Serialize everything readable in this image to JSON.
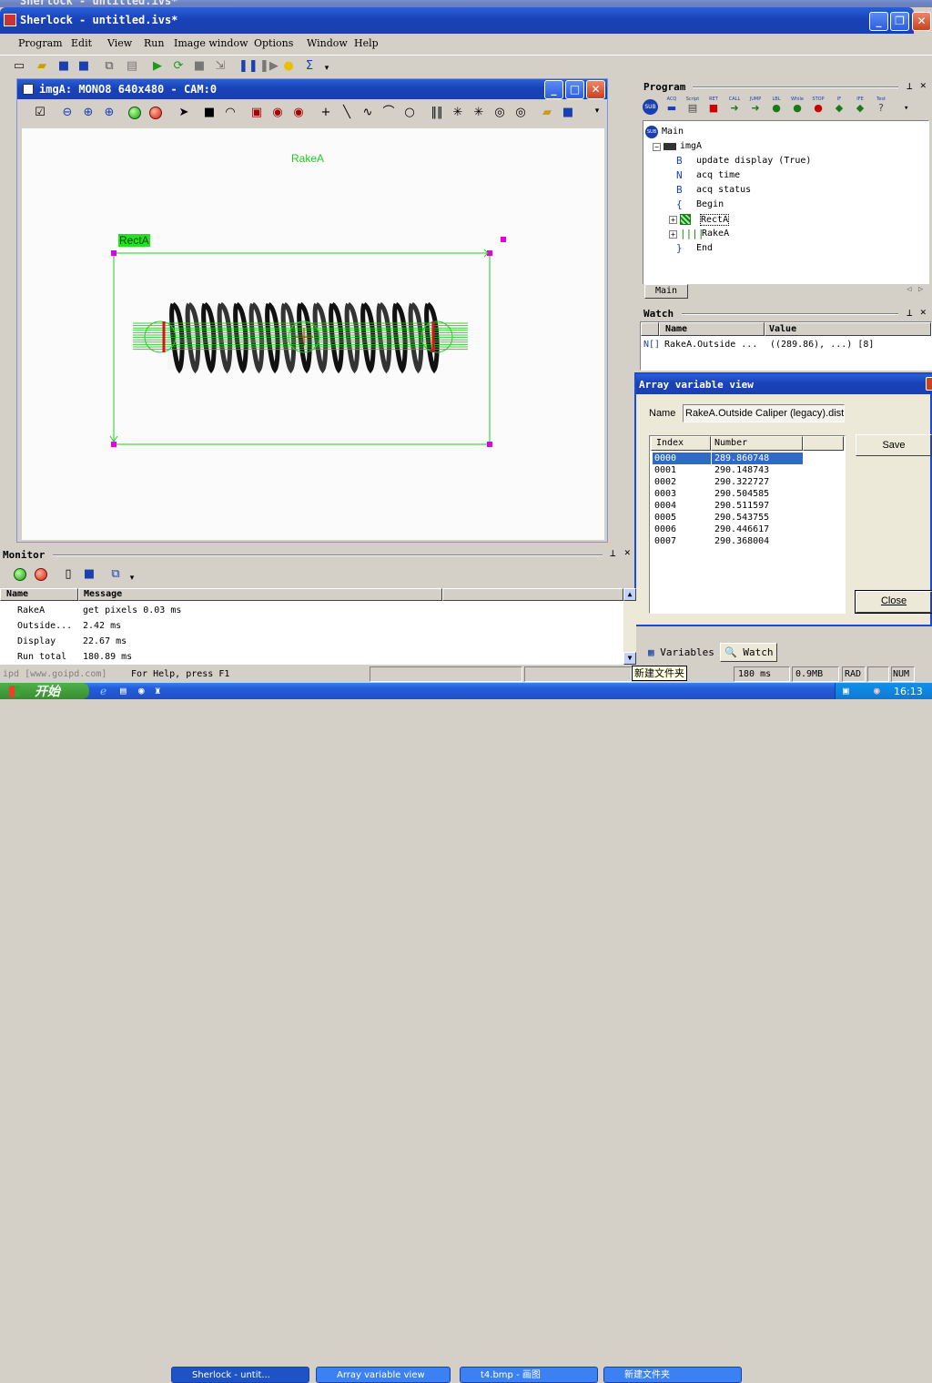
{
  "background_window": {
    "title": "Sherlock - untitled.ivs*"
  },
  "main_window": {
    "title": "Sherlock - untitled.ivs*",
    "menu": [
      "Program",
      "Edit",
      "View",
      "Run",
      "Image window",
      "Options",
      "Window",
      "Help"
    ]
  },
  "image_window": {
    "title": "imgA: MONO8 640x480 - CAM:0",
    "labels": {
      "rake": "RakeA",
      "rect": "RectA"
    }
  },
  "program_panel": {
    "title": "Program",
    "toolbar_labels": [
      "ACQ",
      "Script",
      "RET",
      "CALL",
      "JUMP",
      "LBL",
      "While",
      "STOP",
      "IF",
      "IFE",
      "Test"
    ],
    "tree": [
      {
        "icon": "SUB",
        "label": "Main"
      },
      {
        "icon": "",
        "label": "imgA"
      },
      {
        "icon": "B",
        "label": "update display (True)"
      },
      {
        "icon": "N",
        "label": "acq time"
      },
      {
        "icon": "B",
        "label": "acq status"
      },
      {
        "icon": "{",
        "label": "Begin"
      },
      {
        "icon": "",
        "label": "RectA"
      },
      {
        "icon": "",
        "label": "RakeA"
      },
      {
        "icon": "}",
        "label": "End"
      }
    ],
    "tab": "Main"
  },
  "watch_panel": {
    "title": "Watch",
    "headers": [
      "Name",
      "Value"
    ],
    "rows": [
      {
        "type": "N[]",
        "name": "RakeA.Outside ...",
        "value": "((289.86), ...) [8]"
      }
    ]
  },
  "array_dialog": {
    "title": "Array variable view",
    "name_label": "Name",
    "name_value": "RakeA.Outside Caliper (legacy).dist",
    "headers": [
      "Index",
      "Number"
    ],
    "rows": [
      {
        "index": "0000",
        "number": "289.860748"
      },
      {
        "index": "0001",
        "number": "290.148743"
      },
      {
        "index": "0002",
        "number": "290.322727"
      },
      {
        "index": "0003",
        "number": "290.504585"
      },
      {
        "index": "0004",
        "number": "290.511597"
      },
      {
        "index": "0005",
        "number": "290.543755"
      },
      {
        "index": "0006",
        "number": "290.446617"
      },
      {
        "index": "0007",
        "number": "290.368004"
      }
    ],
    "save_label": "Save",
    "close_label": "Close"
  },
  "bottom_tabs": {
    "variables": "Variables",
    "watch": "Watch"
  },
  "monitor_panel": {
    "title": "Monitor",
    "headers": [
      "Name",
      "Message"
    ],
    "rows": [
      {
        "name": "RakeA",
        "message": "get pixels 0.03 ms"
      },
      {
        "name": "Outside...",
        "message": "2.42 ms"
      },
      {
        "name": "Display",
        "message": "22.67 ms"
      },
      {
        "name": "Run total",
        "message": "180.89 ms"
      }
    ]
  },
  "status_bar": {
    "watermark": "ipd [www.goipd.com]",
    "help_text": "For Help, press F1",
    "tooltip": "新建文件夹",
    "time": "180 ms",
    "memory": "0.9MB",
    "rad": "RAD",
    "num": "NUM"
  },
  "taskbar": {
    "start": "开始",
    "buttons": [
      "Sherlock - untit...",
      "Array variable view",
      "t4.bmp - 画图",
      "新建文件夹"
    ],
    "clock": "16:13"
  },
  "colors": {
    "accent": "#0a246a",
    "graphic_green": "#22cc22",
    "handle_magenta": "#e000e0",
    "xp_blue": "#245edb"
  }
}
